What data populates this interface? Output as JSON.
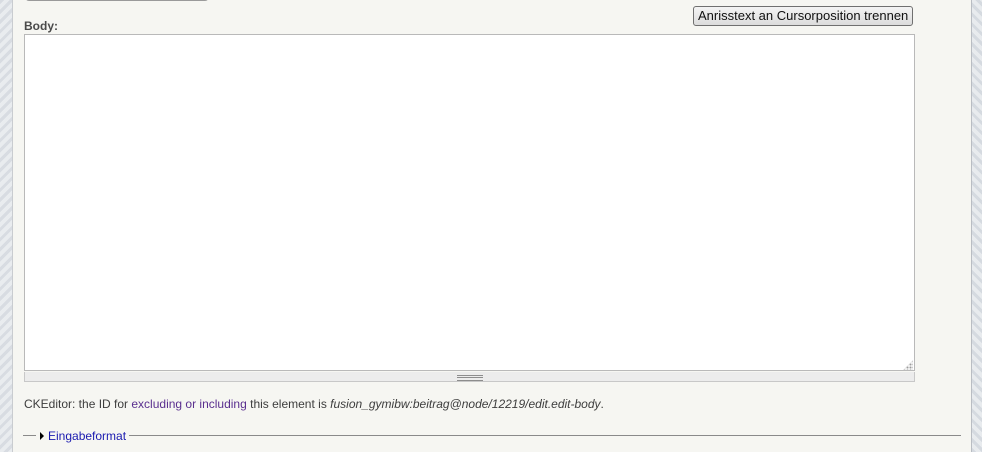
{
  "toolbar": {
    "split_label": "Anrisstext an Cursorposition trennen"
  },
  "body_field": {
    "label": "Body:",
    "value": ""
  },
  "ckeditor_note": {
    "prefix": "CKEditor: the ID for ",
    "link_text": "excluding or including",
    "middle": " this element is ",
    "element_id": "fusion_gymibw:beitrag@node/12219/edit.edit-body",
    "suffix": "."
  },
  "input_format": {
    "legend": "Eingabeformat"
  }
}
